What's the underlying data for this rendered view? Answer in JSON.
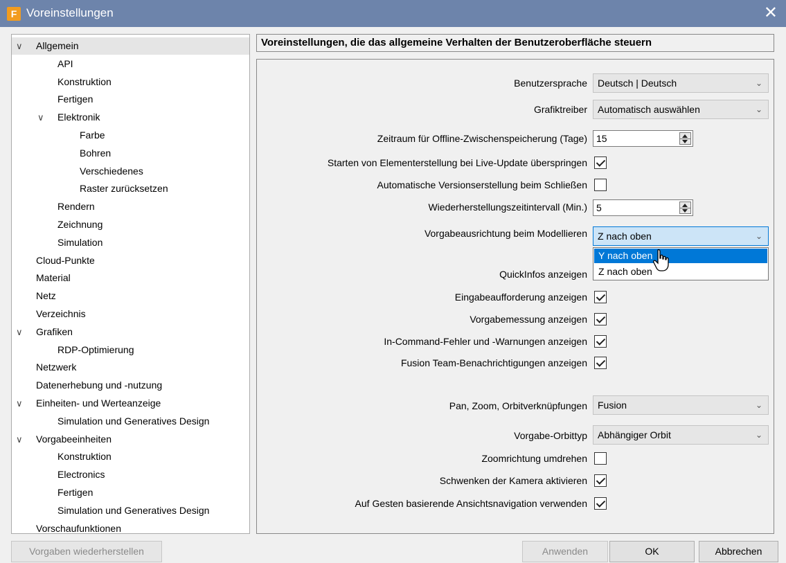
{
  "window": {
    "title": "Voreinstellungen",
    "app_icon_letter": "F",
    "close_glyph": "✕"
  },
  "tree": [
    {
      "label": "Allgemein",
      "level": 0,
      "expandable": true,
      "selected": true
    },
    {
      "label": "API",
      "level": 1
    },
    {
      "label": "Konstruktion",
      "level": 1
    },
    {
      "label": "Fertigen",
      "level": 1
    },
    {
      "label": "Elektronik",
      "level": 1,
      "expandable": true
    },
    {
      "label": "Farbe",
      "level": 2
    },
    {
      "label": "Bohren",
      "level": 2
    },
    {
      "label": "Verschiedenes",
      "level": 2
    },
    {
      "label": "Raster zurücksetzen",
      "level": 2
    },
    {
      "label": "Rendern",
      "level": 1
    },
    {
      "label": "Zeichnung",
      "level": 1
    },
    {
      "label": "Simulation",
      "level": 1
    },
    {
      "label": "Cloud-Punkte",
      "level": 0
    },
    {
      "label": "Material",
      "level": 0
    },
    {
      "label": "Netz",
      "level": 0
    },
    {
      "label": "Verzeichnis",
      "level": 0
    },
    {
      "label": "Grafiken",
      "level": 0,
      "expandable": true
    },
    {
      "label": "RDP-Optimierung",
      "level": 1
    },
    {
      "label": "Netzwerk",
      "level": 0
    },
    {
      "label": "Datenerhebung und -nutzung",
      "level": 0
    },
    {
      "label": "Einheiten- und Werteanzeige",
      "level": 0,
      "expandable": true
    },
    {
      "label": "Simulation und Generatives Design",
      "level": 1
    },
    {
      "label": "Vorgabeeinheiten",
      "level": 0,
      "expandable": true
    },
    {
      "label": "Konstruktion",
      "level": 1
    },
    {
      "label": "Electronics",
      "level": 1
    },
    {
      "label": "Fertigen",
      "level": 1
    },
    {
      "label": "Simulation und Generatives Design",
      "level": 1
    },
    {
      "label": "Vorschaufunktionen",
      "level": 0
    }
  ],
  "panel": {
    "header": "Voreinstellungen, die das allgemeine Verhalten der Benutzeroberfläche steuern"
  },
  "settings": {
    "ui_language": {
      "label": "Benutzersprache",
      "value": "Deutsch | Deutsch"
    },
    "graphics_driver": {
      "label": "Grafiktreiber",
      "value": "Automatisch auswählen"
    },
    "offline_cache": {
      "label": "Zeitraum für Offline-Zwischenspeicherung (Tage)",
      "value": "15"
    },
    "skip_element_creation": {
      "label": "Starten von Elementerstellung bei Live-Update überspringen",
      "checked": true
    },
    "auto_version": {
      "label": "Automatische Versionserstellung beim Schließen",
      "checked": false
    },
    "recovery_interval": {
      "label": "Wiederherstellungszeitintervall (Min.)",
      "value": "5"
    },
    "default_orientation": {
      "label": "Vorgabeausrichtung beim Modellieren",
      "value": "Z nach oben",
      "options": [
        "Y nach oben",
        "Z nach oben"
      ],
      "highlighted": "Y nach oben"
    },
    "quickinfos": {
      "label": "QuickInfos anzeigen",
      "checked": true
    },
    "input_prompt": {
      "label": "Eingabeaufforderung anzeigen",
      "checked": true
    },
    "default_measure": {
      "label": "Vorgabemessung anzeigen",
      "checked": true
    },
    "in_command_errors": {
      "label": "In-Command-Fehler und -Warnungen anzeigen",
      "checked": true
    },
    "team_notifications": {
      "label": "Fusion Team-Benachrichtigungen anzeigen",
      "checked": true
    },
    "pan_zoom_orbit": {
      "label": "Pan, Zoom, Orbitverknüpfungen",
      "value": "Fusion"
    },
    "default_orbit": {
      "label": "Vorgabe-Orbittyp",
      "value": "Abhängiger Orbit"
    },
    "reverse_zoom": {
      "label": "Zoomrichtung umdrehen",
      "checked": false
    },
    "camera_pivot": {
      "label": "Schwenken der Kamera aktivieren",
      "checked": true
    },
    "gesture_nav": {
      "label": "Auf Gesten basierende Ansichtsnavigation verwenden",
      "checked": true
    }
  },
  "buttons": {
    "restore_defaults": "Vorgaben wiederherstellen",
    "apply": "Anwenden",
    "ok": "OK",
    "cancel": "Abbrechen"
  },
  "icons": {
    "chevron": "chevron-down-icon",
    "close": "close-icon",
    "hand_cursor": "hand-cursor-icon"
  }
}
